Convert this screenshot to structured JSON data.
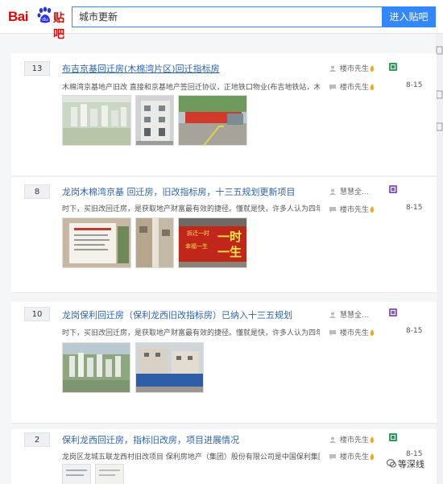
{
  "header": {
    "logo_text": "Bai",
    "logo_tieba": "贴吧",
    "search_value": "城市更新",
    "enter_button": "进入贴吧"
  },
  "threads": [
    {
      "replies": "13",
      "title": "布吉京基回迁房(木棉湾片区)回迁指标房",
      "abstract": "木棉湾京基地产旧改 直接和京基地产签回迁协议，正地铁口物业(布吉地铁站，木棉...",
      "author": "楼市先生",
      "last_reply": "楼市先生",
      "date": "8-15"
    },
    {
      "replies": "8",
      "title": "龙岗木棉湾京基 回迁房，旧改指标房，十三五规划更新项目",
      "abstract": "时下，买旧改回迁房，是获取地产财富最有效的捷径。懂就是快，许多人认为四年、...",
      "author": "慧慧全...",
      "last_reply": "楼市先生",
      "date": "8-15"
    },
    {
      "replies": "10",
      "title": "龙岗保利回迁房（保利龙西旧改指标房）已纳入十三五规划",
      "abstract": "时下，买旧改回迁房，是获取地产财富最有效的捷径。懂就是快，许多人认为四年、...",
      "author": "慧慧全...",
      "last_reply": "楼市先生",
      "date": "8-15"
    },
    {
      "replies": "2",
      "title": "保利龙西回迁房，指标旧改房，项目进展情况",
      "abstract": "龙岗区龙城五联龙西村旧改项目 保利房地产（集团）股份有限公司是中国保利集团控...",
      "author": "楼市先生",
      "last_reply": "楼市先生",
      "date": "8-15"
    }
  ],
  "banner_texts": {
    "line1": "一时",
    "line2": "一生",
    "small1": "拆迁一时",
    "small2": "幸福一生"
  },
  "watermark": "等深线",
  "colors": {
    "accent": "#3388ff",
    "link": "#2d64b3",
    "brand_red": "#e10602",
    "badge_green": "#2e9f57",
    "badge_purple": "#8a5cc8"
  }
}
